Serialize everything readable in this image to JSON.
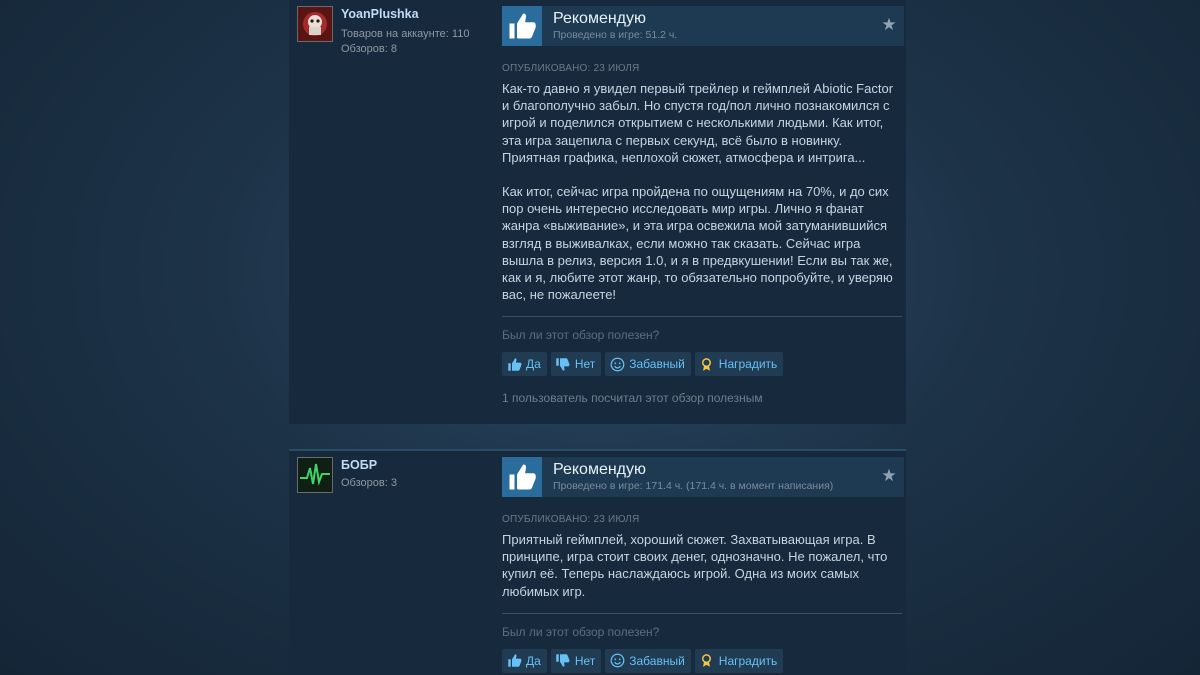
{
  "reviews": [
    {
      "author": {
        "name": "YoanPlushka",
        "products_line": "Товаров на аккаунте: 110",
        "reviews_line": "Обзоров: 8"
      },
      "recommendation": "Рекомендую",
      "hours": "Проведено в игре: 51.2 ч.",
      "posted": "ОПУБЛИКОВАНО: 23 ИЮЛЯ",
      "paragraphs": [
        "Как-то давно я увидел первый трейлер и геймплей Abiotic Factor и благополучно забыл. Но спустя год/пол лично познакомился с игрой и поделился открытием с несколькими людьми. Как итог, эта игра зацепила с первых секунд, всё было в новинку. Приятная графика, неплохой сюжет, атмосфера и интрига...",
        "Как итог, сейчас игра пройдена по ощущениям на 70%, и до сих пор очень интересно исследовать мир игры. Лично я фанат жанра «выживание», и эта игра освежила мой затуманившийся взгляд в выживалках, если можно так сказать. Сейчас игра вышла в релиз, версия 1.0, и я в предвкушении! Если вы так же, как и я, любите этот жанр, то обязательно попробуйте, и уверяю вас, не пожалеете!"
      ],
      "helpful_question": "Был ли этот обзор полезен?",
      "buttons": {
        "yes": "Да",
        "no": "Нет",
        "funny": "Забавный",
        "award": "Наградить"
      },
      "helpful_count": "1 пользователь посчитал этот обзор полезным"
    },
    {
      "author": {
        "name": "БОБР",
        "reviews_line": "Обзоров: 3"
      },
      "recommendation": "Рекомендую",
      "hours": "Проведено в игре: 171.4 ч. (171.4 ч. в момент написания)",
      "posted": "ОПУБЛИКОВАНО: 23 ИЮЛЯ",
      "paragraphs": [
        "Приятный геймплей, хороший сюжет. Захватывающая игра. В принципе, игра стоит своих денег, однозначно. Не пожалел, что купил её. Теперь наслаждаюсь игрой. Одна из моих самых любимых игр."
      ],
      "helpful_question": "Был ли этот обзор полезен?",
      "buttons": {
        "yes": "Да",
        "no": "Нет",
        "funny": "Забавный",
        "award": "Наградить"
      }
    }
  ],
  "icons": {
    "recommend": "thumbs-up-icon",
    "favorite": "star-icon",
    "vote_yes": "thumbs-up-icon",
    "vote_no": "thumbs-down-icon",
    "funny": "smiley-icon",
    "award": "award-icon"
  },
  "colors": {
    "accent": "#67c1f5",
    "thumb_bg": "#2a6d9c"
  }
}
